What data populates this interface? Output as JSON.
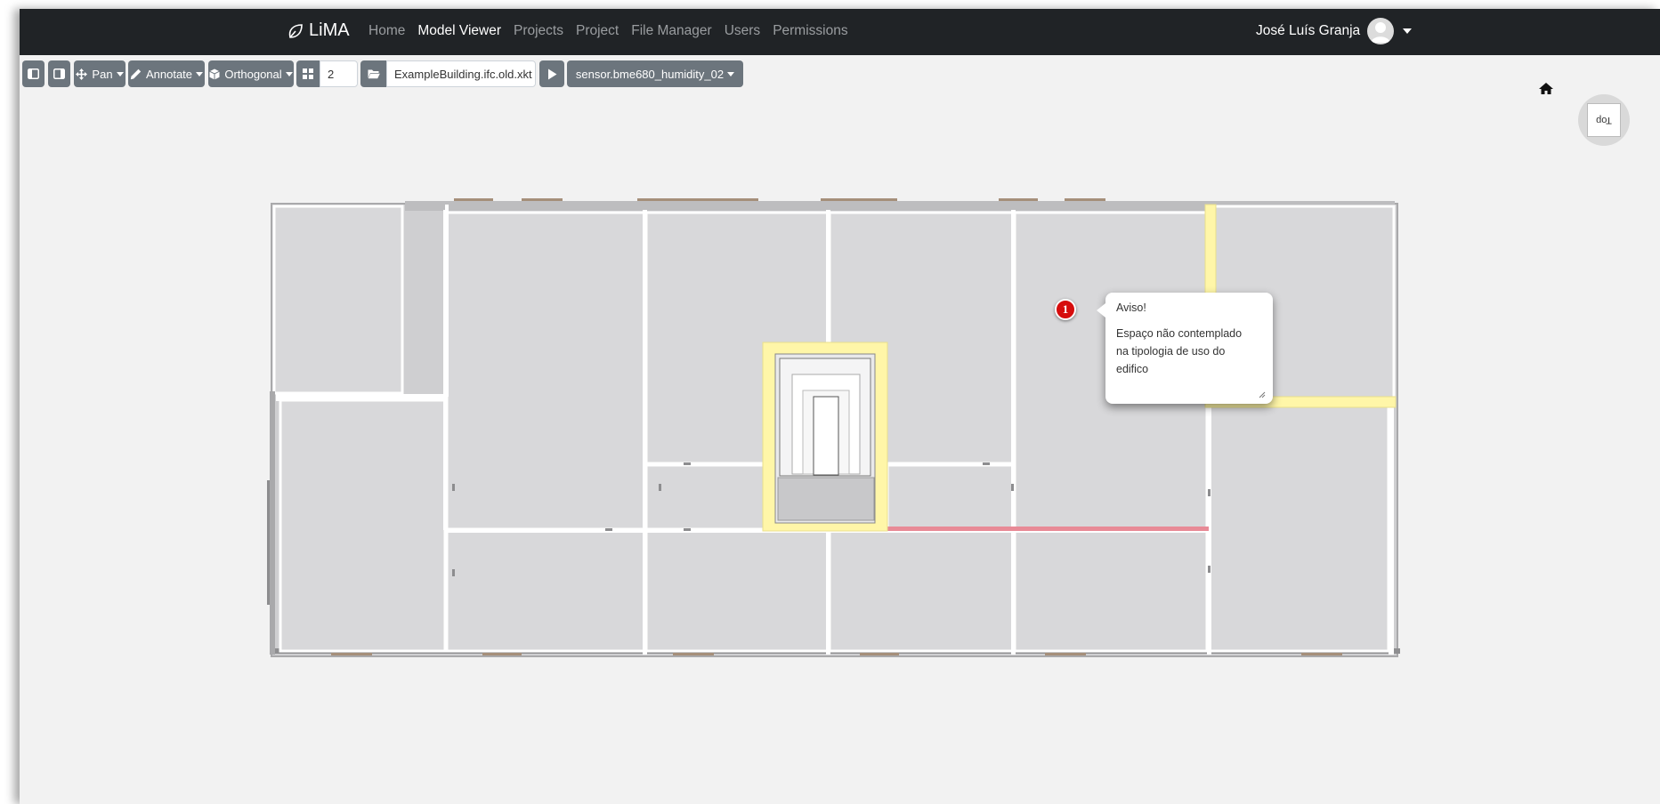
{
  "navbar": {
    "brand": "LiMA",
    "links": [
      {
        "label": "Home",
        "active": false
      },
      {
        "label": "Model Viewer",
        "active": true
      },
      {
        "label": "Projects",
        "active": false
      },
      {
        "label": "Project",
        "active": false
      },
      {
        "label": "File Manager",
        "active": false
      },
      {
        "label": "Users",
        "active": false
      },
      {
        "label": "Permissions",
        "active": false
      }
    ],
    "user_name": "José Luís Granja"
  },
  "toolbar": {
    "left_panel_icon": "sidebar-left-icon",
    "right_panel_icon": "sidebar-right-icon",
    "pan_label": "Pan",
    "annotate_label": "Annotate",
    "projection_label": "Orthogonal",
    "grid_icon": "grid-icon",
    "grid_value": "2",
    "folder_icon": "folder-icon",
    "file_name": "ExampleBuilding.ifc.old.xkt",
    "play_icon": "play-icon",
    "sensor_label": "sensor.bme680_humidity_02"
  },
  "nav_cube": {
    "face_label": "Top"
  },
  "annotation": {
    "number": "1",
    "title": "Aviso!",
    "text": "Espaço não contemplado na tipologia de uso do edifico"
  },
  "colors": {
    "navbar_bg": "#202326",
    "toolbar_btn": "#6c757d",
    "room_fill": "#d8d8da",
    "highlight_yellow": "#fff6a8",
    "highlight_red": "#e88a96",
    "annotation_marker": "#d60d0d"
  }
}
